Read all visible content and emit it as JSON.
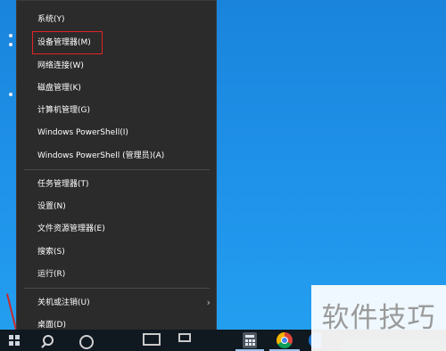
{
  "menu": {
    "items": [
      {
        "label": "系统(Y)"
      },
      {
        "label": "设备管理器(M)",
        "highlighted": true
      },
      {
        "label": "网络连接(W)"
      },
      {
        "label": "磁盘管理(K)"
      },
      {
        "label": "计算机管理(G)"
      },
      {
        "label": "Windows PowerShell(I)"
      },
      {
        "label": "Windows PowerShell (管理员)(A)"
      },
      {
        "label": "任务管理器(T)"
      },
      {
        "label": "设置(N)"
      },
      {
        "label": "文件资源管理器(E)"
      },
      {
        "label": "搜索(S)"
      },
      {
        "label": "运行(R)"
      },
      {
        "label": "关机或注销(U)",
        "has_submenu": true
      },
      {
        "label": "桌面(D)"
      }
    ],
    "submenu_arrow": "›",
    "highlight_color": "#e02424"
  },
  "taskbar": {
    "icons": [
      "windows-start-icon",
      "search-icon",
      "cortana-icon",
      "task-view-icon",
      "monitor-icon",
      "calculator-icon",
      "chrome-icon",
      "app-icon"
    ]
  },
  "watermark": {
    "text": "软件技巧"
  },
  "colors": {
    "desktop": "#1a8ae0",
    "menu_background": "#2b2b2b",
    "taskbar": "#101820"
  }
}
